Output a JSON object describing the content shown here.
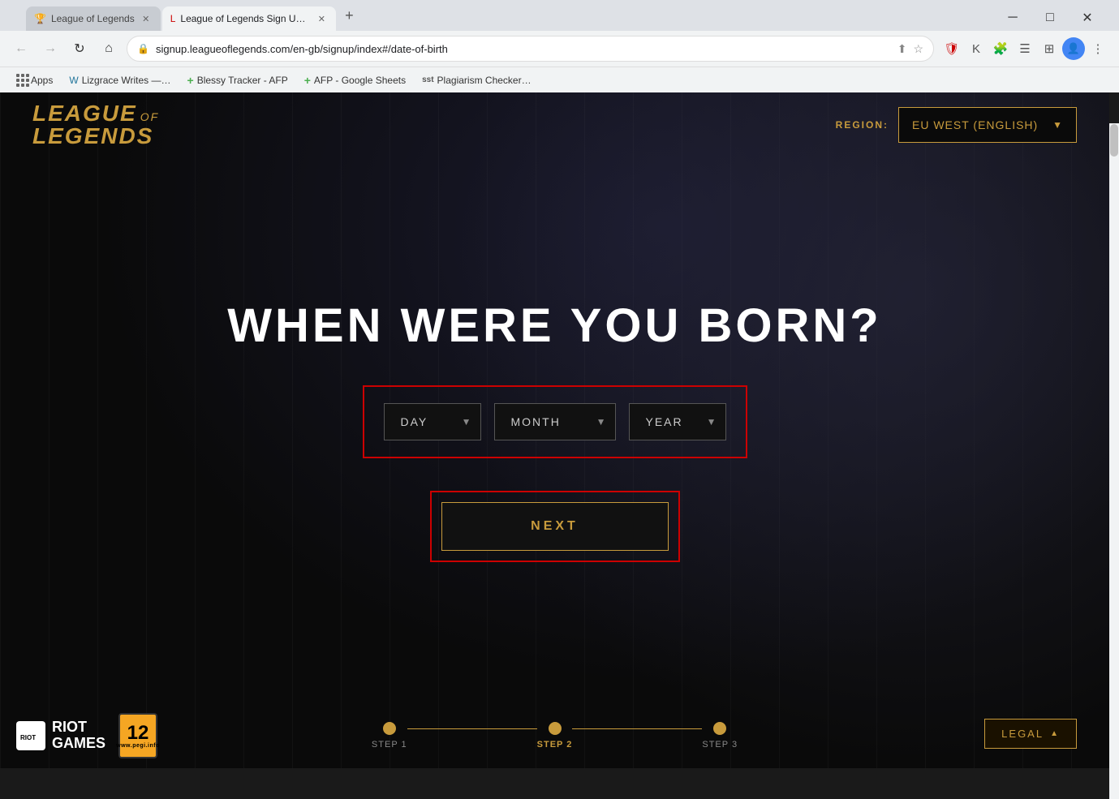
{
  "browser": {
    "tabs": [
      {
        "id": "tab1",
        "title": "League of Legends",
        "active": false,
        "favicon": "🏆"
      },
      {
        "id": "tab2",
        "title": "League of Legends Sign Up | EU",
        "active": true,
        "favicon": "L"
      }
    ],
    "url": "signup.leagueoflegends.com/en-gb/signup/index#/date-of-birth",
    "new_tab_label": "+",
    "nav": {
      "back": "←",
      "forward": "→",
      "reload": "↻",
      "home": "⌂"
    }
  },
  "bookmarks": [
    {
      "id": "apps",
      "label": "Apps",
      "type": "apps"
    },
    {
      "id": "lizgrace",
      "label": "Lizgrace Writes —…",
      "favicon": "W"
    },
    {
      "id": "blessy",
      "label": "Blessy Tracker - AFP",
      "favicon": "+"
    },
    {
      "id": "afp",
      "label": "AFP - Google Sheets",
      "favicon": "+"
    },
    {
      "id": "plagiarism",
      "label": "Plagiarism Checker…",
      "favicon": "sst"
    }
  ],
  "header": {
    "logo_top": "LEAGUE",
    "logo_of": "OF",
    "logo_bottom": "LEGENDS",
    "region_label": "REGION:",
    "region_value": "EU WEST (ENGLISH)",
    "region_arrow": "▼"
  },
  "page": {
    "title": "WHEN WERE YOU BORN?",
    "day_placeholder": "DAY",
    "month_placeholder": "MONTH",
    "year_placeholder": "YEAR",
    "next_label": "NEXT",
    "steps": [
      {
        "label": "STEP 1",
        "active": false
      },
      {
        "label": "STEP 2",
        "active": true
      },
      {
        "label": "STEP 3",
        "active": false
      }
    ],
    "legal_label": "LEGAL",
    "legal_arrow": "▲"
  },
  "footer": {
    "riot_line1": "RIOT",
    "riot_line2": "GAMES",
    "pegi_number": "12",
    "pegi_sub": "www.pegi.info"
  },
  "colors": {
    "gold": "#c89b3c",
    "red_outline": "#cc0000",
    "dark_bg": "#0a0a0a"
  }
}
